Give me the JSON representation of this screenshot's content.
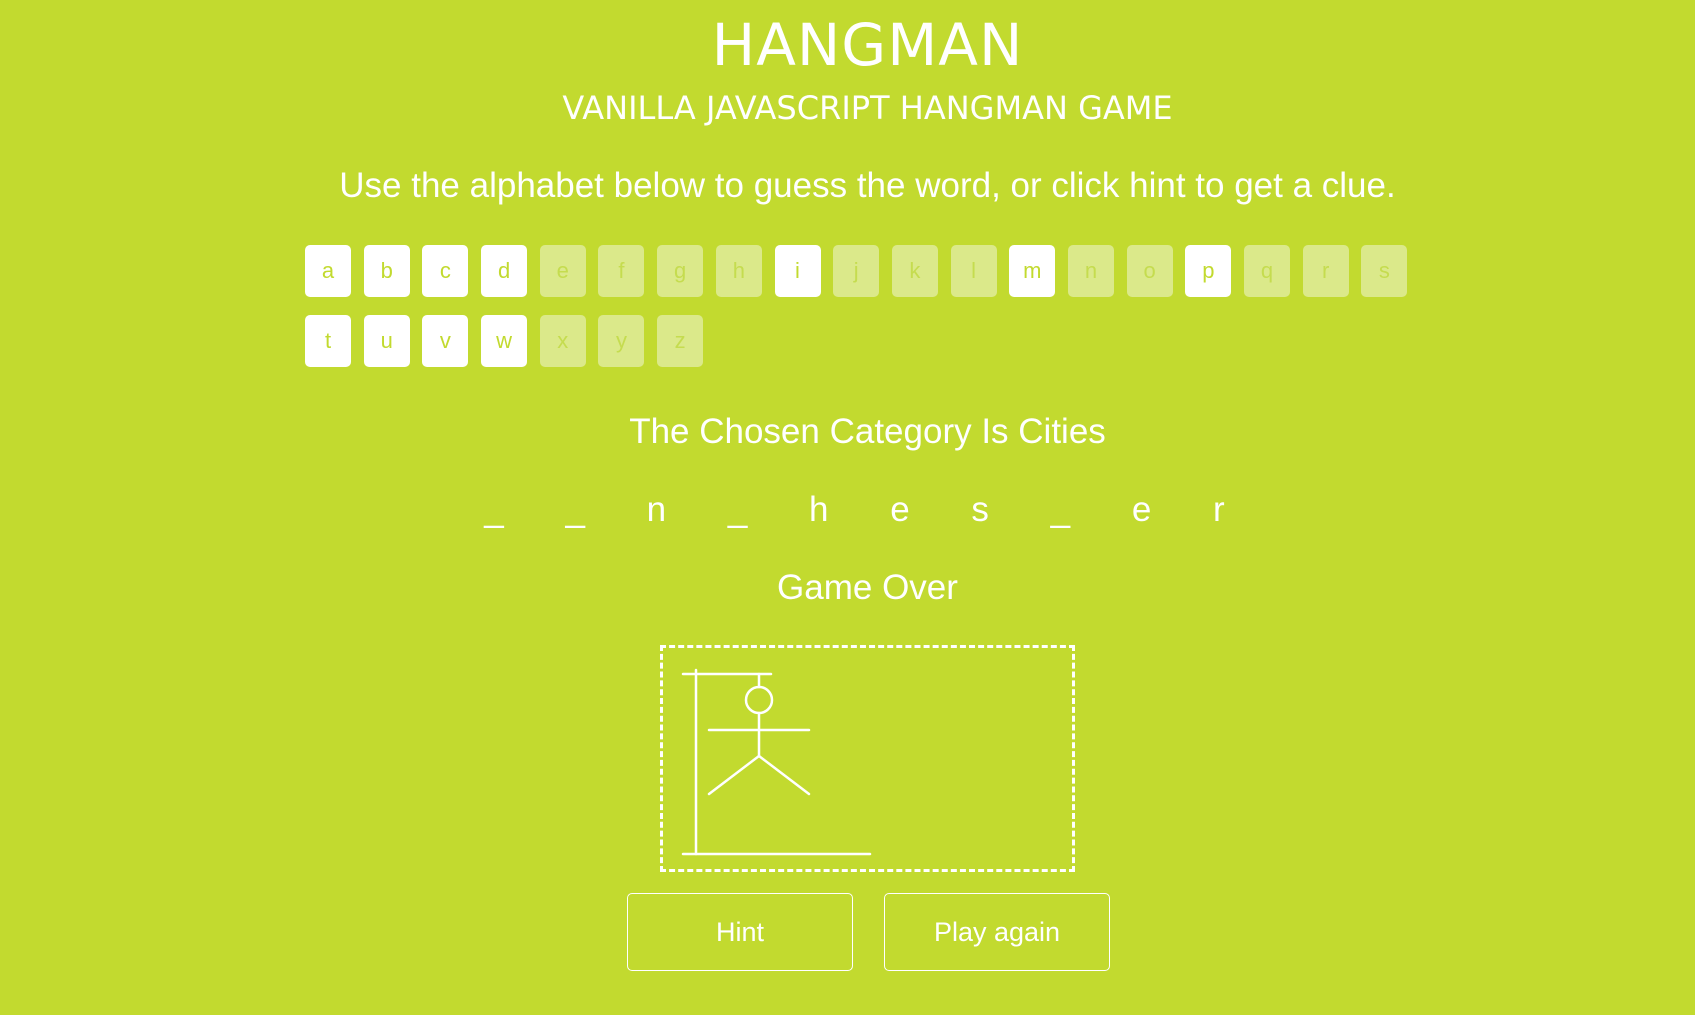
{
  "header": {
    "title": "HANGMAN",
    "subtitle": "VANILLA JAVASCRIPT HANGMAN GAME",
    "instructions": "Use the alphabet below to guess the word, or click hint to get a clue."
  },
  "alphabet": [
    {
      "letter": "a",
      "used": false
    },
    {
      "letter": "b",
      "used": false
    },
    {
      "letter": "c",
      "used": false
    },
    {
      "letter": "d",
      "used": false
    },
    {
      "letter": "e",
      "used": true
    },
    {
      "letter": "f",
      "used": true
    },
    {
      "letter": "g",
      "used": true
    },
    {
      "letter": "h",
      "used": true
    },
    {
      "letter": "i",
      "used": false
    },
    {
      "letter": "j",
      "used": true
    },
    {
      "letter": "k",
      "used": true
    },
    {
      "letter": "l",
      "used": true
    },
    {
      "letter": "m",
      "used": false
    },
    {
      "letter": "n",
      "used": true
    },
    {
      "letter": "o",
      "used": true
    },
    {
      "letter": "p",
      "used": false
    },
    {
      "letter": "q",
      "used": true
    },
    {
      "letter": "r",
      "used": true
    },
    {
      "letter": "s",
      "used": true
    },
    {
      "letter": "t",
      "used": false
    },
    {
      "letter": "u",
      "used": false
    },
    {
      "letter": "v",
      "used": false
    },
    {
      "letter": "w",
      "used": false
    },
    {
      "letter": "x",
      "used": true
    },
    {
      "letter": "y",
      "used": true
    },
    {
      "letter": "z",
      "used": true
    }
  ],
  "game": {
    "category": "The Chosen Category Is Cities",
    "word_display": "_ _ n _ h e s _ e r",
    "status": "Game Over"
  },
  "buttons": {
    "hint": "Hint",
    "play_again": "Play again"
  },
  "colors": {
    "background": "#c2da2f",
    "letter_available_bg": "#ffffff",
    "letter_used_bg": "#dbe98a",
    "foreground": "#ffffff"
  }
}
